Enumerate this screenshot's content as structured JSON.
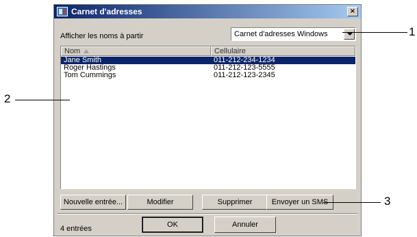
{
  "window": {
    "title": "Carnet d'adresses",
    "close_glyph": "×"
  },
  "source": {
    "label": "Afficher les noms à partir",
    "selected": "Carnet d'adresses Windows"
  },
  "list": {
    "columns": [
      "Nom",
      "Cellulaire"
    ],
    "rows": [
      {
        "name": "Jane Smith",
        "phone": "011-212-234-1234",
        "selected": true
      },
      {
        "name": "Roger Hastings",
        "phone": "011-212-123-5555",
        "selected": false
      },
      {
        "name": "Tom Cummings",
        "phone": "011-212-123-2345",
        "selected": false
      }
    ]
  },
  "actions": {
    "new": "Nouvelle entrée...",
    "edit": "Modifier",
    "delete": "Supprimer",
    "sms": "Envoyer un SMS"
  },
  "footer": {
    "count": "4 entrées",
    "ok": "OK",
    "cancel": "Annuler"
  },
  "callouts": [
    "1",
    "2",
    "3"
  ],
  "colors": {
    "title_bar": "#0a246a",
    "selection": "#0a246a",
    "dialog_bg": "#d4d0c8"
  }
}
